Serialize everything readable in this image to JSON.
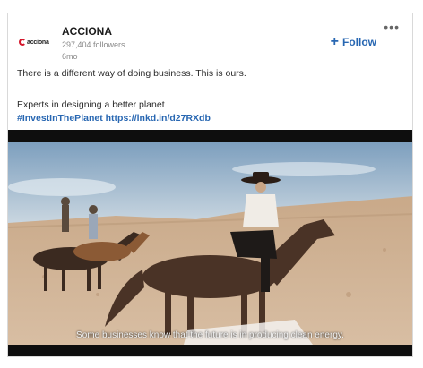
{
  "post": {
    "company_name": "ACCIONA",
    "logo_text": "acciona",
    "followers": "297,404 followers",
    "age": "6mo",
    "follow_label": "Follow",
    "more_icon": "more-horizontal-icon",
    "text_line1": "There is a different way of doing business. This is ours.",
    "text_line2": "Experts in designing a better planet",
    "hashtag": "#InvestInThePlanet",
    "link": "https://lnkd.in/d27RXdb"
  },
  "video": {
    "subtitle": "Some businesses know that the future is in producing clean energy."
  },
  "colors": {
    "accent": "#2867b2",
    "brand_red": "#d4162b"
  }
}
